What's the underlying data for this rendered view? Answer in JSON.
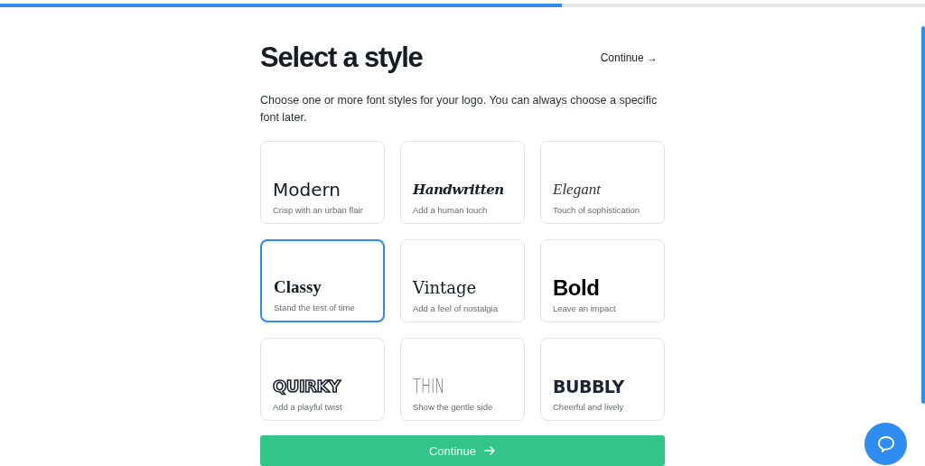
{
  "progress": {
    "level": 0.607
  },
  "header": {
    "title": "Select a style",
    "skip_link": "Continue →"
  },
  "description": "Choose one or more font styles for your logo. You can always choose a specific font later.",
  "styles": [
    {
      "kind": "modern",
      "name": "Modern",
      "tagline": "Crisp with an urban flair",
      "selected": false
    },
    {
      "kind": "handwritten",
      "name": "Handwritten",
      "tagline": "Add a human touch",
      "selected": false
    },
    {
      "kind": "elegant",
      "name": "Elegant",
      "tagline": "Touch of sophistication",
      "selected": false
    },
    {
      "kind": "classy",
      "name": "Classy",
      "tagline": "Stand the test of time",
      "selected": true
    },
    {
      "kind": "vintage",
      "name": "Vintage",
      "tagline": "Add a feel of nostalgia",
      "selected": false
    },
    {
      "kind": "bold",
      "name": "Bold",
      "tagline": "Leave an impact",
      "selected": false
    },
    {
      "kind": "quirky",
      "name": "QUIRKY",
      "tagline": "Add a playful twist",
      "selected": false
    },
    {
      "kind": "thin",
      "name": "THIN",
      "tagline": "Show the gentle side",
      "selected": false
    },
    {
      "kind": "bubbly",
      "name": "BUBBLY",
      "tagline": "Cheerful and lively",
      "selected": false
    }
  ],
  "continue_button": "Continue"
}
